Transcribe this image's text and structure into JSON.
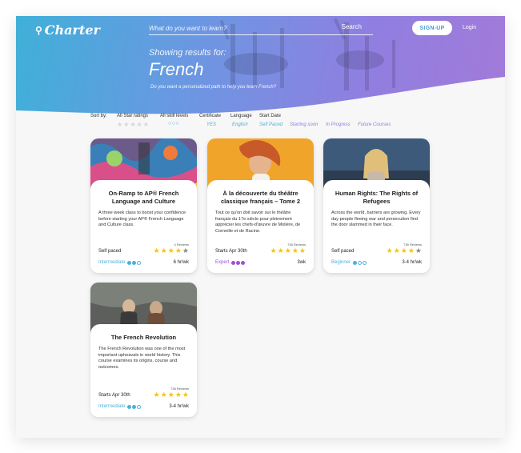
{
  "header": {
    "logo": "Charter",
    "search_placeholder": "What do you want to learn?",
    "search_button": "Search",
    "signup": "SIGN-UP",
    "login": "Login"
  },
  "hero": {
    "showing": "Showing results for:",
    "query": "French",
    "personalized": "Do you want a personalized path to help you learn French?"
  },
  "filters": {
    "sort_by": "Sort by:",
    "star_ratings": {
      "label": "All Star ratings",
      "stars": "★★★★★"
    },
    "skill_levels": {
      "label": "All skill levels",
      "circles": "○○○"
    },
    "certificate": {
      "label": "Certificate",
      "value": "YES"
    },
    "language": {
      "label": "Language",
      "value": "English"
    },
    "start_date": {
      "label": "Start Date"
    },
    "date_options": [
      "Self Paced",
      "Starting soon",
      "In Progress",
      "Future Courses"
    ]
  },
  "colors": {
    "accent_blue": "#4db0dd",
    "accent_purple": "#8f7fe0",
    "star_gold": "#f0c419",
    "expert_purple": "#a24ed4"
  },
  "courses": [
    {
      "title": "On-Ramp to AP® French Language and Culture",
      "description": "A three week class to boost your confidence before starting your AP® French Language and Culture class.",
      "reviews": "4 Reviews",
      "pace": "Self paced",
      "rating": 4,
      "level": "Intermediate",
      "level_dots": 2,
      "hours": "6 hr/wk"
    },
    {
      "title": "À la découverte du théâtre classique français – Tome 2",
      "description": "Tout ce qu'on doit savoir sur le théâtre français du 17e siècle pour pleinement apprécier les chefs-d'œuvre de Molière, de Corneille et de Racine.",
      "reviews": "738 Reviews",
      "pace": "Starts Apr 30th",
      "rating": 5,
      "level": "Expert",
      "level_dots": 3,
      "hours": "3wk"
    },
    {
      "title": "Human Rights: The Rights of Refugees",
      "description": "Across the world, barriers are growing. Every day people fleeing war and persecution find the door slammed in their face.",
      "reviews": "738 Reviews",
      "pace": "Self paced",
      "rating": 4,
      "level": "Beginner",
      "level_dots": 1,
      "hours": "3-4 hr/wk"
    },
    {
      "title": "The French Revolution",
      "description": "The French Revolution was one of the most important upheavals in world history. This course examines its origins, course and outcomes.",
      "reviews": "738 Reviews",
      "pace": "Starts Apr 30th",
      "rating": 5,
      "level": "Intermediate",
      "level_dots": 2,
      "hours": "3-4 hr/wk"
    }
  ]
}
